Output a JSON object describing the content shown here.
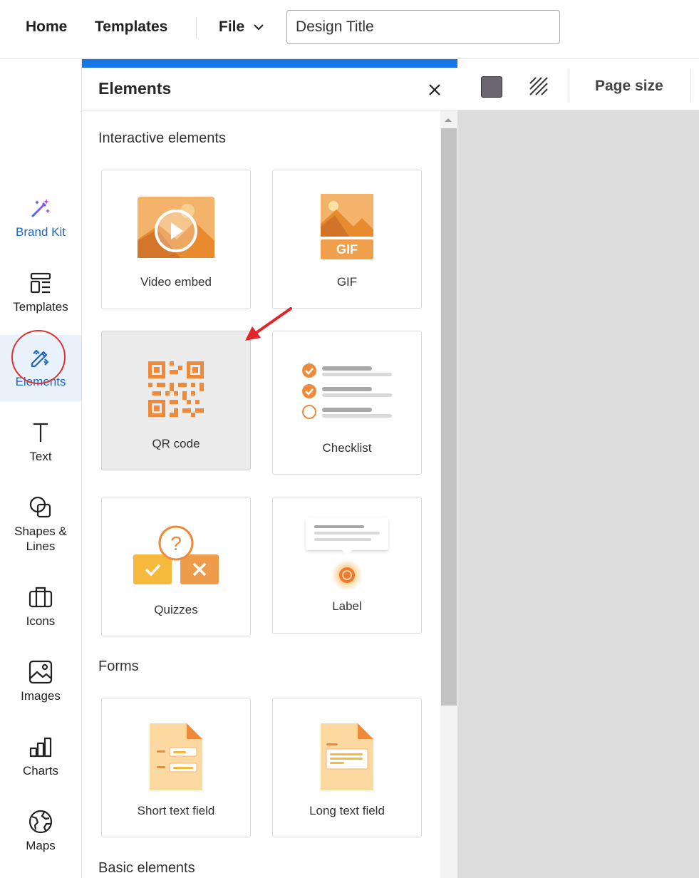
{
  "header": {
    "home_label": "Home",
    "templates_label": "Templates",
    "file_label": "File",
    "design_title_value": "Design Title"
  },
  "sidebar": {
    "items": [
      {
        "label": "Brand Kit",
        "icon": "magic-wand-icon"
      },
      {
        "label": "Templates",
        "icon": "templates-icon"
      },
      {
        "label": "Elements",
        "icon": "elements-icon",
        "active": true
      },
      {
        "label": "Text",
        "icon": "text-icon"
      },
      {
        "label": "Shapes &\nLines",
        "icon": "shapes-icon"
      },
      {
        "label": "Icons",
        "icon": "briefcase-icon"
      },
      {
        "label": "Images",
        "icon": "image-icon"
      },
      {
        "label": "Charts",
        "icon": "chart-icon"
      },
      {
        "label": "Maps",
        "icon": "globe-icon"
      }
    ]
  },
  "panel": {
    "title": "Elements",
    "sections": {
      "interactive": "Interactive elements",
      "forms": "Forms",
      "basic": "Basic elements"
    },
    "cards": {
      "video_embed": "Video embed",
      "gif": "GIF",
      "gif_badge": "GIF",
      "qr_code": "QR code",
      "checklist": "Checklist",
      "quizzes": "Quizzes",
      "label": "Label",
      "short_text": "Short text field",
      "long_text": "Long text field"
    }
  },
  "toolbar": {
    "page_size_label": "Page size",
    "swatch_color": "#6b6670"
  },
  "colors": {
    "accent": "#1776e6",
    "orange": "#ef8c3a",
    "annotation_red": "#e03131"
  }
}
